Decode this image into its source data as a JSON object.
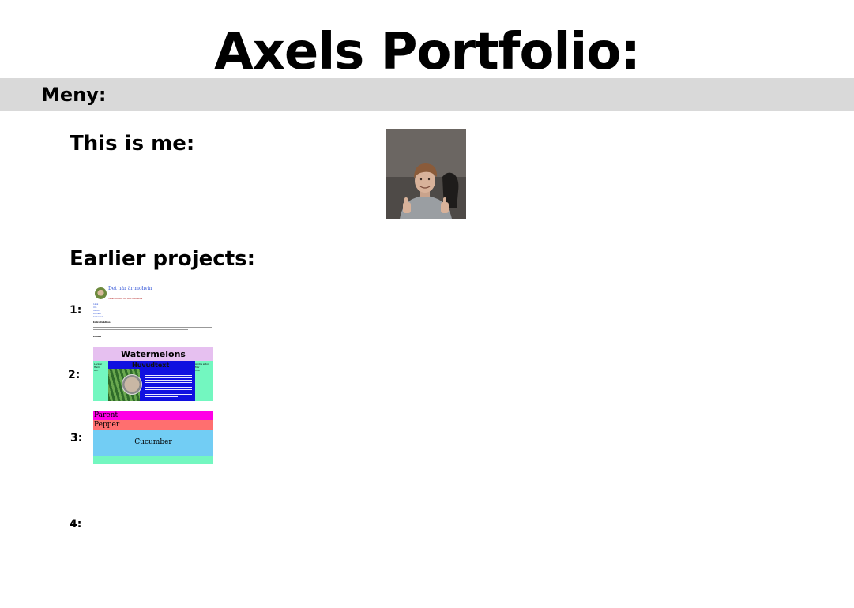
{
  "header": {
    "title": "Axels Portfolio:"
  },
  "menu": {
    "label": "Meny:"
  },
  "about": {
    "heading": "This is me:"
  },
  "projects": {
    "heading": "Earlier projects:",
    "items": [
      {
        "number": "1:",
        "thumb": {
          "title": "Det här är mohvin",
          "subtitle": "Välkommen till min hemsida",
          "links": [
            "Länk",
            "Om",
            "Galleri",
            "Kontakt",
            "Sidhuvud"
          ],
          "heading1": "Introduktion",
          "heading2": "Bilder"
        }
      },
      {
        "number": "2:",
        "thumb": {
          "header": "Watermelons",
          "main_title": "Huvudtext",
          "left_text": [
            "Länkar",
            "Hem",
            "Om"
          ],
          "right_text": [
            "Andra sidor",
            "Mer",
            "Info"
          ]
        }
      },
      {
        "number": "3:",
        "thumb": {
          "parent": "Parent",
          "pepper": "Pepper",
          "cucumber": "Cucumber"
        }
      },
      {
        "number": "4:"
      }
    ]
  },
  "colors": {
    "menu_bg": "#d9d9d9",
    "thumb2_header": "#e6c0f0",
    "thumb2_bg": "#73f7c0",
    "thumb2_center": "#1010e0",
    "thumb3_parent": "#ff00e6",
    "thumb3_pepper": "#ff6f6f",
    "thumb3_cucumber": "#72cdf4"
  }
}
